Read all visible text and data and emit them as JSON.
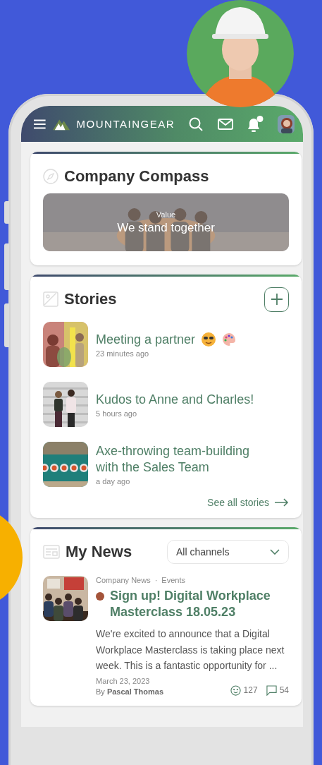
{
  "header": {
    "brand": "MOUNTAINGEAR",
    "notification": true
  },
  "compass": {
    "title": "Company Compass",
    "label": "Value",
    "value": "We stand together"
  },
  "stories": {
    "title": "Stories",
    "items": [
      {
        "title": "Meeting a partner",
        "time": "23 minutes ago",
        "trailing_icons": [
          {
            "kind": "sunglasses"
          },
          {
            "kind": "palette"
          }
        ]
      },
      {
        "title": "Kudos to Anne and Charles!",
        "time": "5 hours ago"
      },
      {
        "title": "Axe-throwing team-building with the Sales Team",
        "time": "a day ago"
      }
    ],
    "link": "See all stories"
  },
  "news": {
    "title": "My News",
    "filter": "All channels",
    "items": [
      {
        "channels": [
          "Company News",
          "Events"
        ],
        "separator": "·",
        "unread": true,
        "title": "Sign up! Digital Workplace Masterclass 18.05.23",
        "excerpt": "We're excited to announce that a Digital Workplace Masterclass is taking place next week. This is a fantastic opportunity for ...",
        "date": "March 23, 2023",
        "author": "By **Pascal Thomas**",
        "reactions": "127",
        "comments": "54"
      }
    ]
  }
}
